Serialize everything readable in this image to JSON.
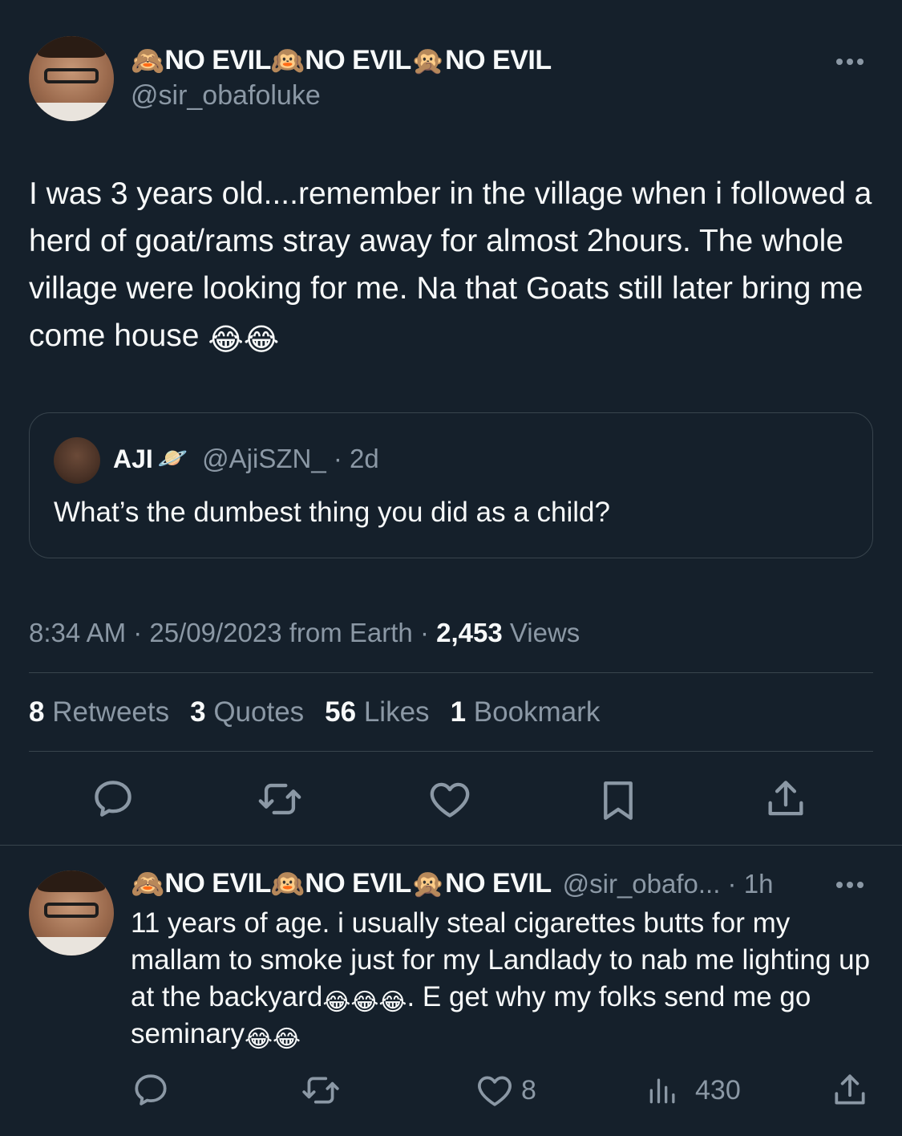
{
  "main_tweet": {
    "display_name": {
      "emoji_1": "🙈",
      "seg_1": "NO EVIL",
      "emoji_2": "🙉",
      "seg_2": "NO EVIL",
      "emoji_3": "🙊",
      "seg_3": "NO EVIL"
    },
    "handle": "@sir_obafoluke",
    "text": "I was 3 years old....remember in the village when i followed a herd of goat/rams stray away for almost 2hours. The whole village were looking for me. Na that Goats still later bring me come house",
    "text_emoji": "😂😂",
    "quoted": {
      "name": "AJI",
      "name_emoji": "🪐",
      "handle_time": "@AjiSZN_ · 2d",
      "text": "What’s the dumbest thing you did as a child?"
    },
    "meta": {
      "time": "8:34 AM · 25/09/2023 from Earth · ",
      "views_count": "2,453",
      "views_label": " Views"
    },
    "stats": [
      {
        "count": "8",
        "label": "Retweets"
      },
      {
        "count": "3",
        "label": "Quotes"
      },
      {
        "count": "56",
        "label": "Likes"
      },
      {
        "count": "1",
        "label": "Bookmark"
      }
    ]
  },
  "reply": {
    "display_name": {
      "emoji_1": "🙈",
      "seg_1": "NO EVIL",
      "emoji_2": "🙉",
      "seg_2": "NO EVIL",
      "emoji_3": "🙊",
      "seg_3": "NO EVIL"
    },
    "handle_time": "@sir_obafo... · 1h",
    "text_1": "11 years of age.   i usually steal cigarettes butts for my mallam to smoke just for my Landlady to nab me lighting up at the backyard",
    "emoji_1": "😂😂😂",
    "text_2": ". E get why my folks send me go seminary",
    "emoji_2": "😂😂",
    "like_count": "8",
    "view_count": "430"
  },
  "icons": [
    "reply-icon",
    "retweet-icon",
    "like-icon",
    "bookmark-icon",
    "share-icon",
    "views-icon",
    "more-icon"
  ]
}
